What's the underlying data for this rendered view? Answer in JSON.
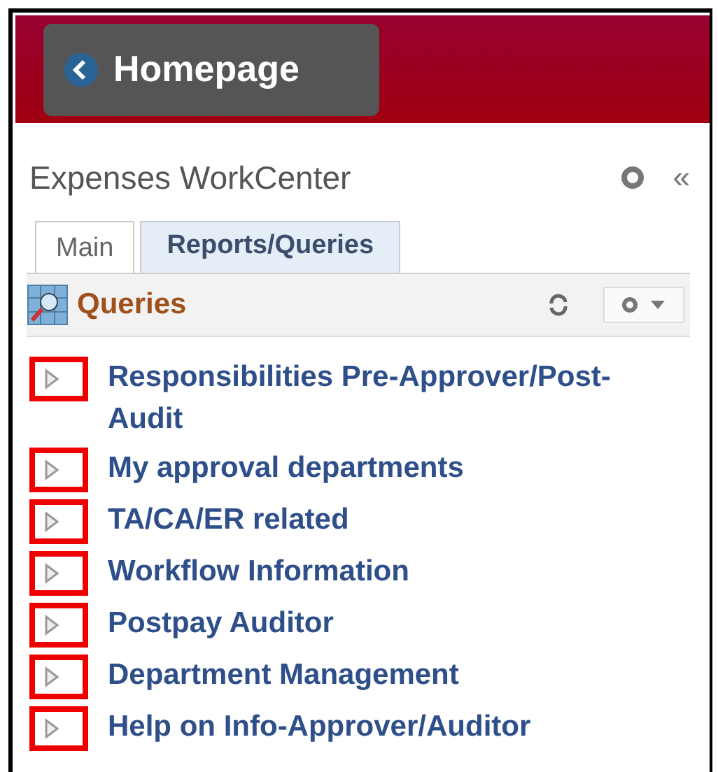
{
  "header": {
    "back_button": "Homepage"
  },
  "panel": {
    "title": "Expenses WorkCenter",
    "collapse_glyph": "«"
  },
  "tabs": [
    {
      "label": "Main",
      "selected": false
    },
    {
      "label": "Reports/Queries",
      "selected": true
    }
  ],
  "section": {
    "title": "Queries"
  },
  "queries": [
    {
      "label": "Responsibilities Pre-Approver/Post-Audit"
    },
    {
      "label": "My approval departments"
    },
    {
      "label": "TA/CA/ER related"
    },
    {
      "label": "Workflow Information"
    },
    {
      "label": "Postpay Auditor"
    },
    {
      "label": "Department Management"
    },
    {
      "label": "Help on Info-Approver/Auditor"
    }
  ]
}
